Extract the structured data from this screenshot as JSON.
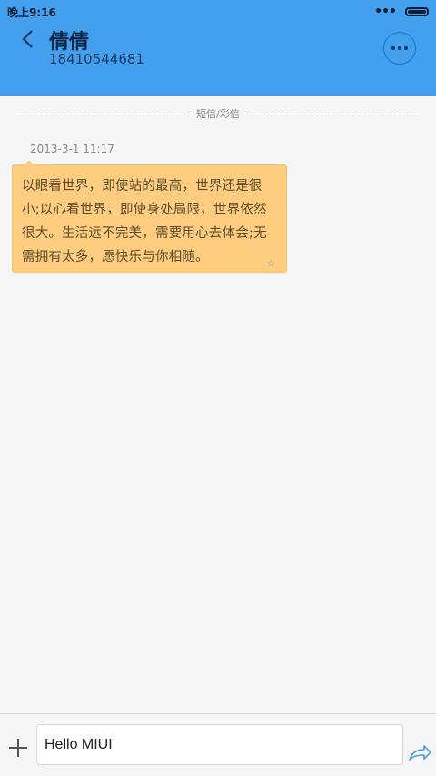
{
  "status_bar": {
    "time": "晚上9:16",
    "signal": "•••"
  },
  "header": {
    "name": "倩倩",
    "number": "18410544681",
    "back_icon": "chevron-left-icon",
    "more_icon": "more-horizontal-icon"
  },
  "conversation": {
    "divider_label": "短信/彩信",
    "messages": [
      {
        "timestamp": "2013-3-1 11:17",
        "text": "以眼看世界，即使站的最高，世界还是很小;以心看世界，即使身处局限，世界依然很大。生活远不完美，需要用心去体会;无需拥有太多，愿快乐与你相随。",
        "status_icon": "star-icon"
      }
    ]
  },
  "composer": {
    "input_value": "Hello MIUI",
    "add_icon": "plus-icon",
    "send_icon": "send-arrow-icon"
  },
  "colors": {
    "header_bg": "#42a0ee",
    "bubble_bg": "#fecd80",
    "page_bg": "#f6f6f6"
  }
}
